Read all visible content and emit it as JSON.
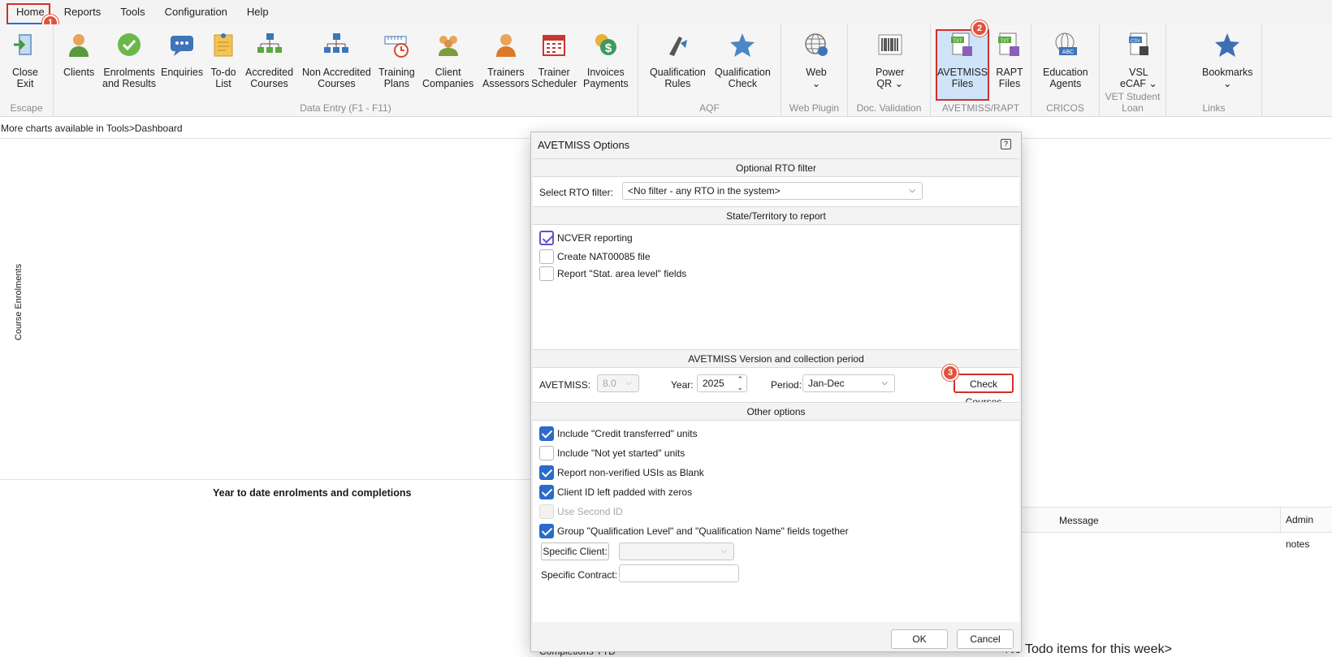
{
  "menu": {
    "items": [
      "Home",
      "Reports",
      "Tools",
      "Configuration",
      "Help"
    ]
  },
  "ribbon": {
    "groups": [
      {
        "label": "Escape"
      },
      {
        "label": "Data Entry (F1 - F11)"
      },
      {
        "label": "AQF"
      },
      {
        "label": "Web Plugin"
      },
      {
        "label": "Doc. Validation"
      },
      {
        "label": "AVETMISS/RAPT"
      },
      {
        "label": "CRICOS"
      },
      {
        "label": "VET Student Loan"
      },
      {
        "label": "Links"
      }
    ],
    "buttons": [
      {
        "l1": "Close",
        "l2": "Exit",
        "icon": "exit-door-icon"
      },
      {
        "l1": "Clients",
        "l2": "",
        "icon": "person-icon"
      },
      {
        "l1": "Enrolments",
        "l2": "and Results",
        "icon": "checkmark-icon"
      },
      {
        "l1": "Enquiries",
        "l2": "",
        "icon": "chat-bubble-icon"
      },
      {
        "l1": "To-do",
        "l2": "List",
        "icon": "notepad-icon"
      },
      {
        "l1": "Accredited",
        "l2": "Courses",
        "icon": "org-chart-icon"
      },
      {
        "l1": "Non Accredited",
        "l2": "Courses",
        "icon": "org-chart-icon"
      },
      {
        "l1": "Training",
        "l2": "Plans",
        "icon": "ruler-clock-icon"
      },
      {
        "l1": "Client",
        "l2": "Companies",
        "icon": "group-icon"
      },
      {
        "l1": "Trainers",
        "l2": "Assessors",
        "icon": "trainer-icon"
      },
      {
        "l1": "Trainer",
        "l2": "Scheduler",
        "icon": "calendar-icon"
      },
      {
        "l1": "Invoices",
        "l2": "Payments",
        "icon": "dollar-coins-icon"
      },
      {
        "l1": "Qualification",
        "l2": "Rules",
        "icon": "pen-tool-icon"
      },
      {
        "l1": "Qualification",
        "l2": "Check",
        "icon": "star-icon"
      },
      {
        "l1": "Web",
        "l2": "⌄",
        "icon": "globe-icon"
      },
      {
        "l1": "Power",
        "l2": "QR ⌄",
        "icon": "barcode-icon"
      },
      {
        "l1": "AVETMISS",
        "l2": "Files",
        "icon": "txt-file-icon"
      },
      {
        "l1": "RAPT",
        "l2": "Files",
        "icon": "txt-file-icon"
      },
      {
        "l1": "Education",
        "l2": "Agents",
        "icon": "abc-globe-icon"
      },
      {
        "l1": "VSL",
        "l2": "eCAF ⌄",
        "icon": "csv-file-icon"
      },
      {
        "l1": "Bookmarks",
        "l2": "⌄",
        "icon": "star-icon"
      }
    ]
  },
  "badges": [
    "1",
    "2",
    "3"
  ],
  "dashboard": {
    "charts_note": "More charts available in Tools>Dashboard",
    "y_axis_label": "Course Enrolments",
    "ytd_title": "Year to date enrolments and completions",
    "msg_columns": [
      "Message",
      "Admin notes"
    ],
    "no_todo": "<No Todo items for this week>",
    "completions_legend": "Completions YTD"
  },
  "dialog": {
    "title": "AVETMISS Options",
    "help": "?",
    "rto_section": "Optional RTO filter",
    "rto_label": "Select RTO filter:",
    "rto_value": "<No filter - any RTO in the system>",
    "state_section": "State/Territory to report",
    "state_checks": [
      {
        "label": "NCVER reporting",
        "checked": true
      },
      {
        "label": "Create NAT00085 file",
        "checked": false
      },
      {
        "label": "Report \"Stat. area level\" fields",
        "checked": false
      }
    ],
    "version_section": "AVETMISS Version and collection period",
    "avetmiss_label": "AVETMISS:",
    "avetmiss_value": "8.0",
    "year_label": "Year:",
    "year_value": "2025",
    "period_label": "Period:",
    "period_value": "Jan-Dec",
    "check_courses": "Check Courses",
    "other_section": "Other options",
    "other_checks": [
      {
        "label": "Include \"Credit transferred\" units",
        "checked": true,
        "enabled": true
      },
      {
        "label": "Include \"Not yet started\" units",
        "checked": false,
        "enabled": true
      },
      {
        "label": "Report non-verified USIs as Blank",
        "checked": true,
        "enabled": true
      },
      {
        "label": "Client ID left padded with zeros",
        "checked": true,
        "enabled": true
      },
      {
        "label": "Use Second ID",
        "checked": false,
        "enabled": false
      },
      {
        "label": "Group \"Qualification Level\" and \"Qualification Name\" fields together",
        "checked": true,
        "enabled": true
      }
    ],
    "specific_client": "Specific Client:",
    "specific_client_value": "",
    "specific_contract": "Specific Contract:",
    "specific_contract_value": "",
    "ok": "OK",
    "cancel": "Cancel"
  },
  "colors": {
    "accent": "#2b6bc9",
    "highlight_border": "#d0302f",
    "badge": "#e0533b"
  }
}
